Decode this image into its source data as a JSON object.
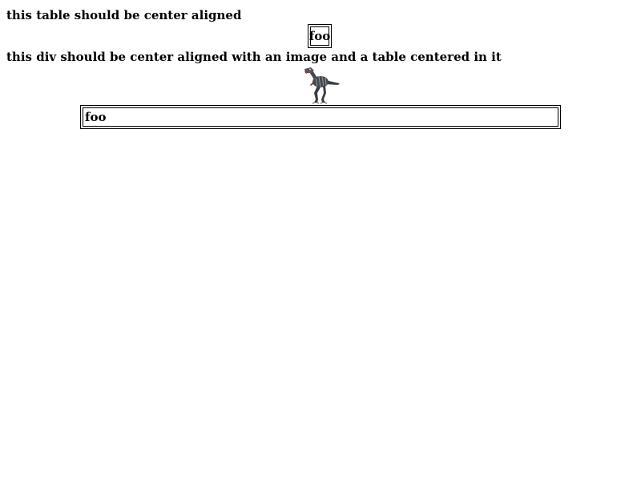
{
  "caption_table": "this table should be center aligned",
  "caption_div": "this div should be center aligned with an image and a table centered in it",
  "small_table": {
    "cell": "foo"
  },
  "wide_table": {
    "cell": "foo"
  },
  "image": {
    "icon": "dinosaur-image"
  }
}
